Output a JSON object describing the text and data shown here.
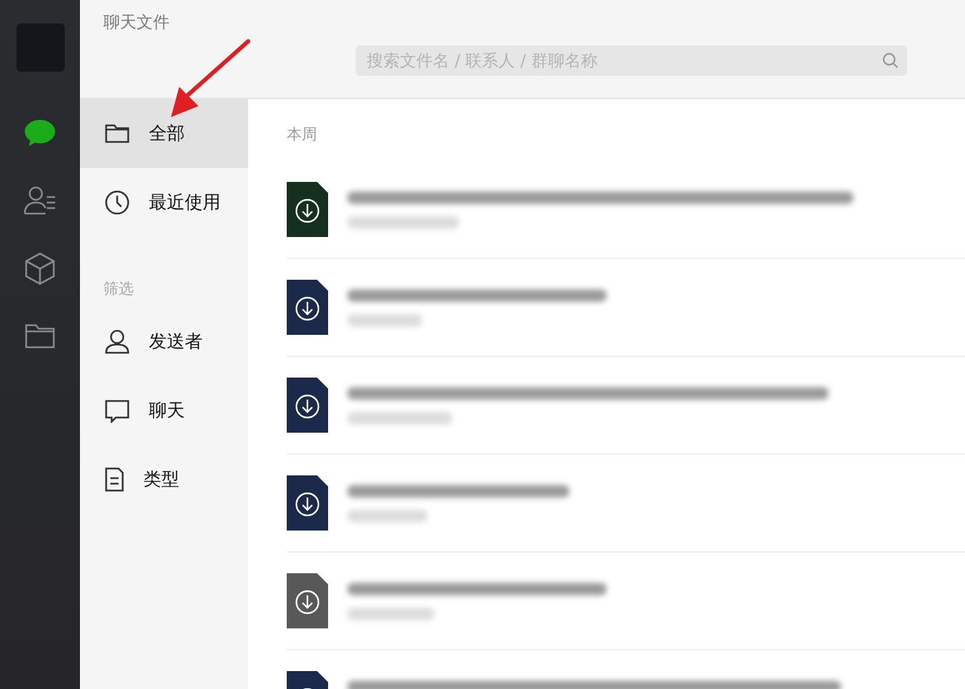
{
  "window": {
    "title": "聊天文件"
  },
  "search": {
    "placeholder": "搜索文件名 / 联系人 / 群聊名称"
  },
  "nav": [
    {
      "kind": "folder",
      "label": "全部",
      "selected": true
    },
    {
      "kind": "clock",
      "label": "最近使用",
      "selected": false
    }
  ],
  "filter": {
    "title": "筛选",
    "items": [
      {
        "kind": "person",
        "label": "发送者",
        "selected": false
      },
      {
        "kind": "chat",
        "label": "聊天",
        "selected": false
      },
      {
        "kind": "doc",
        "label": "类型",
        "selected": false
      }
    ]
  },
  "section": "本周",
  "files": [
    {
      "color": "#16301f"
    },
    {
      "color": "#1b2a4a"
    },
    {
      "color": "#1b2a4a"
    },
    {
      "color": "#1b2a4a"
    },
    {
      "color": "#585858"
    },
    {
      "color": "#1b2a4a"
    }
  ]
}
